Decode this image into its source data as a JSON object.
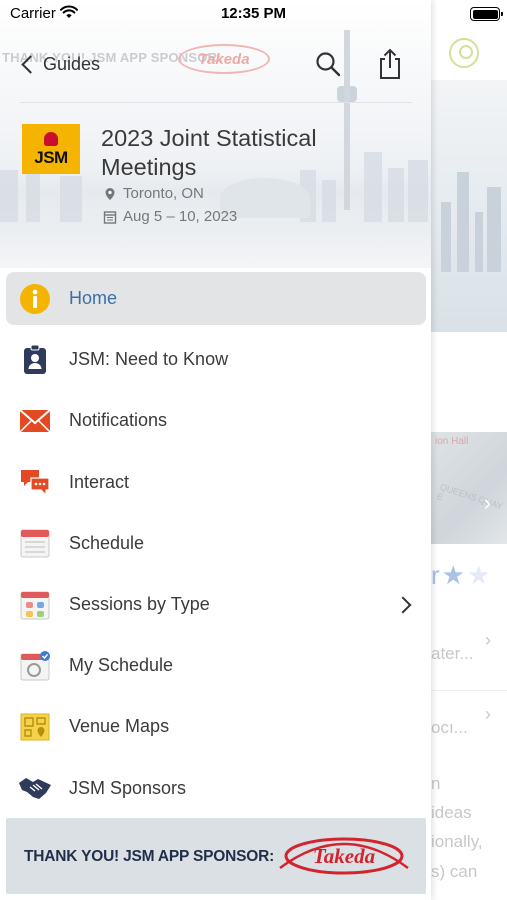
{
  "status_bar": {
    "carrier": "Carrier",
    "time": "12:35 PM"
  },
  "header": {
    "back_label": "Guides",
    "sponsor_watermark": "THANK YOU! JSM APP SPONSOR:",
    "sponsor_watermark_logo": "Takeda",
    "search_icon": "search-icon",
    "share_icon": "share-icon"
  },
  "event": {
    "logo_text": "JSM",
    "title": "2023 Joint Statistical Meetings",
    "location": "Toronto, ON",
    "dates": "Aug 5 – 10, 2023"
  },
  "menu": {
    "items": [
      {
        "label": "Home",
        "icon": "info-icon",
        "active": true,
        "color": "#f5b400"
      },
      {
        "label": "JSM: Need to Know",
        "icon": "badge-icon",
        "color": "#2e3b5b"
      },
      {
        "label": "Notifications",
        "icon": "envelope-icon",
        "color": "#e34a24"
      },
      {
        "label": "Interact",
        "icon": "chat-bubbles-icon",
        "color": "#e34a24"
      },
      {
        "label": "Schedule",
        "icon": "calendar-icon",
        "color": "#e05a5a"
      },
      {
        "label": "Sessions by Type",
        "icon": "grid-calendar-icon",
        "chevron": true,
        "color": "#e05a5a"
      },
      {
        "label": "My Schedule",
        "icon": "calendar-check-icon",
        "color": "#3a7bd5"
      },
      {
        "label": "Venue Maps",
        "icon": "map-icon",
        "color": "#f0c419"
      },
      {
        "label": "JSM Sponsors",
        "icon": "handshake-icon",
        "color": "#2e3b5b"
      }
    ]
  },
  "footer": {
    "sponsor_text": "THANK YOU! JSM APP SPONSOR:",
    "sponsor_logo": "Takeda"
  },
  "background_screen": {
    "photo_caption": "ion Hall",
    "photo_street": "QUEENS QUAY E",
    "lines": [
      "ater...",
      "ocı...",
      "n",
      "ideas",
      "ionally,",
      "s) can"
    ],
    "rating_filled": 1,
    "rating_total": 2
  },
  "colors": {
    "accent": "#3a6fa8",
    "highlight": "#e3e4e6",
    "takeda_red": "#d3232e"
  }
}
